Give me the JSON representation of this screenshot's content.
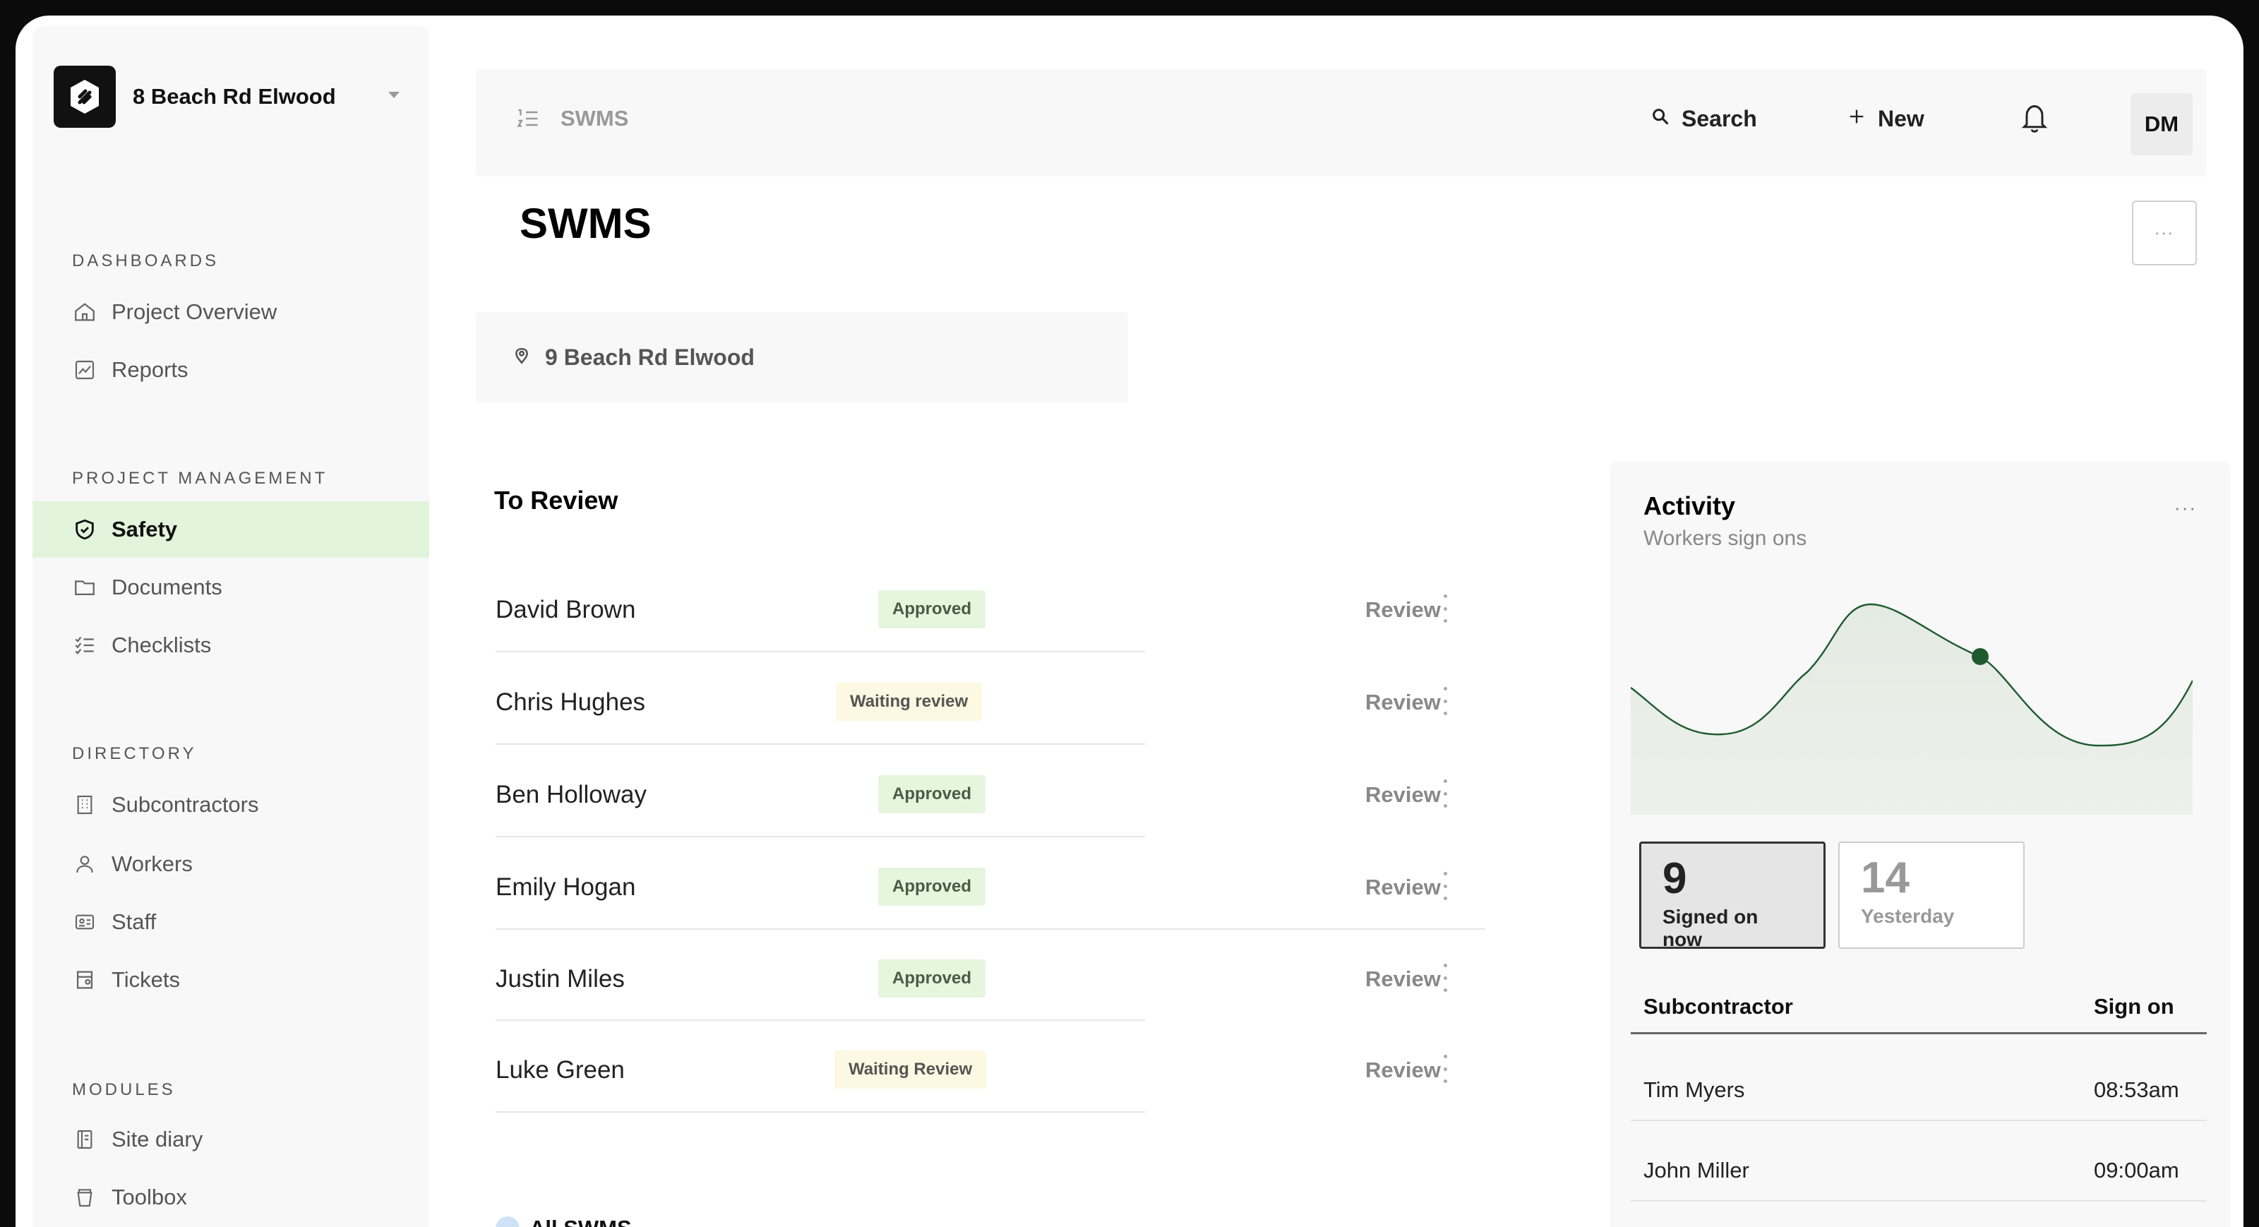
{
  "sidebar": {
    "project_name": "8 Beach Rd Elwood",
    "sections": [
      {
        "label": "DASHBOARDS"
      },
      {
        "label": "PROJECT MANAGEMENT"
      },
      {
        "label": "DIRECTORY"
      },
      {
        "label": "MODULES"
      }
    ],
    "items": [
      {
        "label": "Project Overview",
        "icon": "home-icon"
      },
      {
        "label": "Reports",
        "icon": "chart-icon"
      },
      {
        "label": "Safety",
        "icon": "shield-icon",
        "active": true
      },
      {
        "label": "Documents",
        "icon": "folder-icon"
      },
      {
        "label": "Checklists",
        "icon": "checklist-icon"
      },
      {
        "label": "Subcontractors",
        "icon": "building-icon"
      },
      {
        "label": "Workers",
        "icon": "user-icon"
      },
      {
        "label": "Staff",
        "icon": "id-card-icon"
      },
      {
        "label": "Tickets",
        "icon": "ticket-icon"
      },
      {
        "label": "Site diary",
        "icon": "book-icon"
      },
      {
        "label": "Toolbox",
        "icon": "cup-icon"
      }
    ]
  },
  "topbar": {
    "breadcrumb": "SWMS",
    "search_label": "Search",
    "new_label": "New",
    "avatar_initials": "DM"
  },
  "page": {
    "title": "SWMS",
    "more_label": "···",
    "location": "9 Beach Rd Elwood"
  },
  "to_review": {
    "title": "To Review",
    "action_label": "Review",
    "rows": [
      {
        "name": "David Brown",
        "status": "Approved",
        "kind": "approved"
      },
      {
        "name": "Chris Hughes",
        "status": "Waiting review",
        "kind": "waiting"
      },
      {
        "name": "Ben Holloway",
        "status": "Approved",
        "kind": "approved"
      },
      {
        "name": "Emily Hogan",
        "status": "Approved",
        "kind": "approved"
      },
      {
        "name": "Justin Miles",
        "status": "Approved",
        "kind": "approved"
      },
      {
        "name": "Luke Green",
        "status": "Waiting Review",
        "kind": "waiting"
      }
    ]
  },
  "all_swms_label": "All SWMS",
  "activity": {
    "title": "Activity",
    "subtitle": "Workers sign ons",
    "more_label": "···",
    "signed_on_now": {
      "value": "9",
      "label": "Signed on now"
    },
    "yesterday": {
      "value": "14",
      "label": "Yesterday"
    },
    "table": {
      "col_subcontractor": "Subcontractor",
      "col_sign_on": "Sign on",
      "rows": [
        {
          "name": "Tim Myers",
          "time": "08:53am"
        },
        {
          "name": "John Miller",
          "time": "09:00am"
        }
      ]
    }
  },
  "colors": {
    "active_nav_bg": "#e2f4dc",
    "approved_bg": "#e5f5de",
    "waiting_bg": "#fcf8e1",
    "chart_line": "#1f5a2e"
  }
}
